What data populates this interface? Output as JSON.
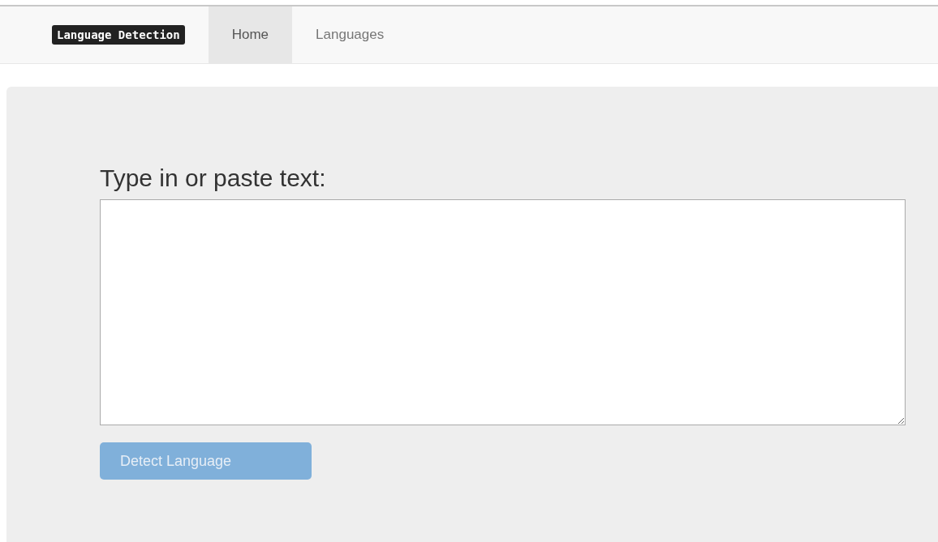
{
  "navbar": {
    "brand": "Language Detection",
    "tabs": [
      {
        "label": "Home",
        "selected": true
      },
      {
        "label": "Languages",
        "selected": false
      }
    ]
  },
  "main": {
    "label": "Type in or paste text:",
    "button": {
      "label": "Detect Language",
      "disabled": true
    }
  }
}
